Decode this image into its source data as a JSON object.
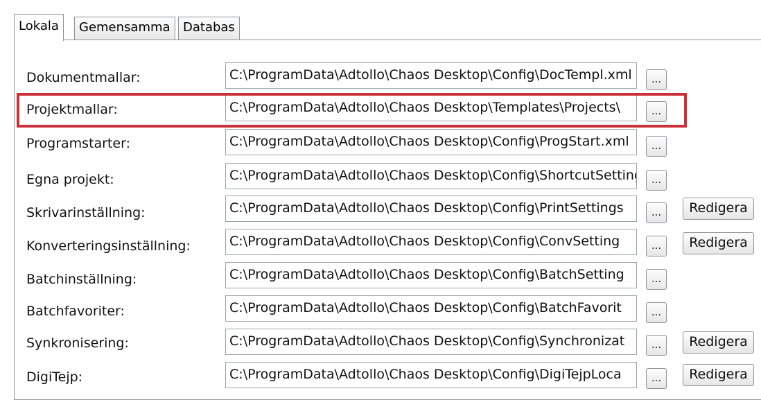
{
  "tabs": [
    {
      "label": "Lokala",
      "active": true
    },
    {
      "label": "Gemensamma",
      "active": false
    },
    {
      "label": "Databas",
      "active": false
    }
  ],
  "browse_label": "...",
  "edit_label": "Redigera",
  "rows": [
    {
      "label": "Dokumentmallar:",
      "path": "C:\\ProgramData\\Adtollo\\Chaos Desktop\\Config\\DocTempl.xml",
      "has_edit": false
    },
    {
      "label": "Projektmallar:",
      "path": "C:\\ProgramData\\Adtollo\\Chaos Desktop\\Templates\\Projects\\",
      "has_edit": false,
      "highlighted": true
    },
    {
      "label": "Programstarter:",
      "path": "C:\\ProgramData\\Adtollo\\Chaos Desktop\\Config\\ProgStart.xml",
      "has_edit": false
    },
    {
      "label": "Egna projekt:",
      "path": "C:\\ProgramData\\Adtollo\\Chaos Desktop\\Config\\ShortcutSettings",
      "has_edit": false
    },
    {
      "label": "Skrivarinställning:",
      "path": "C:\\ProgramData\\Adtollo\\Chaos Desktop\\Config\\PrintSettings",
      "has_edit": true
    },
    {
      "label": "Konverteringsinställning:",
      "path": "C:\\ProgramData\\Adtollo\\Chaos Desktop\\Config\\ConvSetting",
      "has_edit": true
    },
    {
      "label": "Batchinställning:",
      "path": "C:\\ProgramData\\Adtollo\\Chaos Desktop\\Config\\BatchSetting",
      "has_edit": false
    },
    {
      "label": "Batchfavoriter:",
      "path": "C:\\ProgramData\\Adtollo\\Chaos Desktop\\Config\\BatchFavorit",
      "has_edit": false
    },
    {
      "label": "Synkronisering:",
      "path": "C:\\ProgramData\\Adtollo\\Chaos Desktop\\Config\\Synchronizat",
      "has_edit": true
    },
    {
      "label": "DigiTejp:",
      "path": "C:\\ProgramData\\Adtollo\\Chaos Desktop\\Config\\DigiTejpLoca",
      "has_edit": true
    }
  ],
  "colors": {
    "highlight": "#cc2f37",
    "border": "#8f9399"
  }
}
